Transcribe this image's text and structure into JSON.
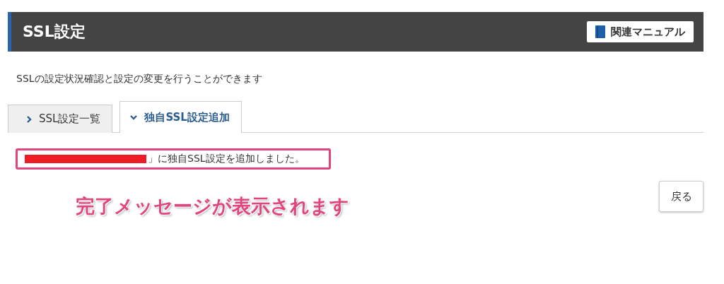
{
  "header": {
    "title": "SSL設定",
    "manual_button": "関連マニュアル"
  },
  "description": "SSLの設定状況確認と設定の変更を行うことができます",
  "tabs": [
    {
      "label": "SSL設定一覧",
      "selected": false
    },
    {
      "label": "独自SSL設定追加",
      "selected": true
    }
  ],
  "message": {
    "redacted": true,
    "text": "」に独自SSL設定を追加しました。"
  },
  "annotation": "完了メッセージが表示されます",
  "back_button": "戻る"
}
